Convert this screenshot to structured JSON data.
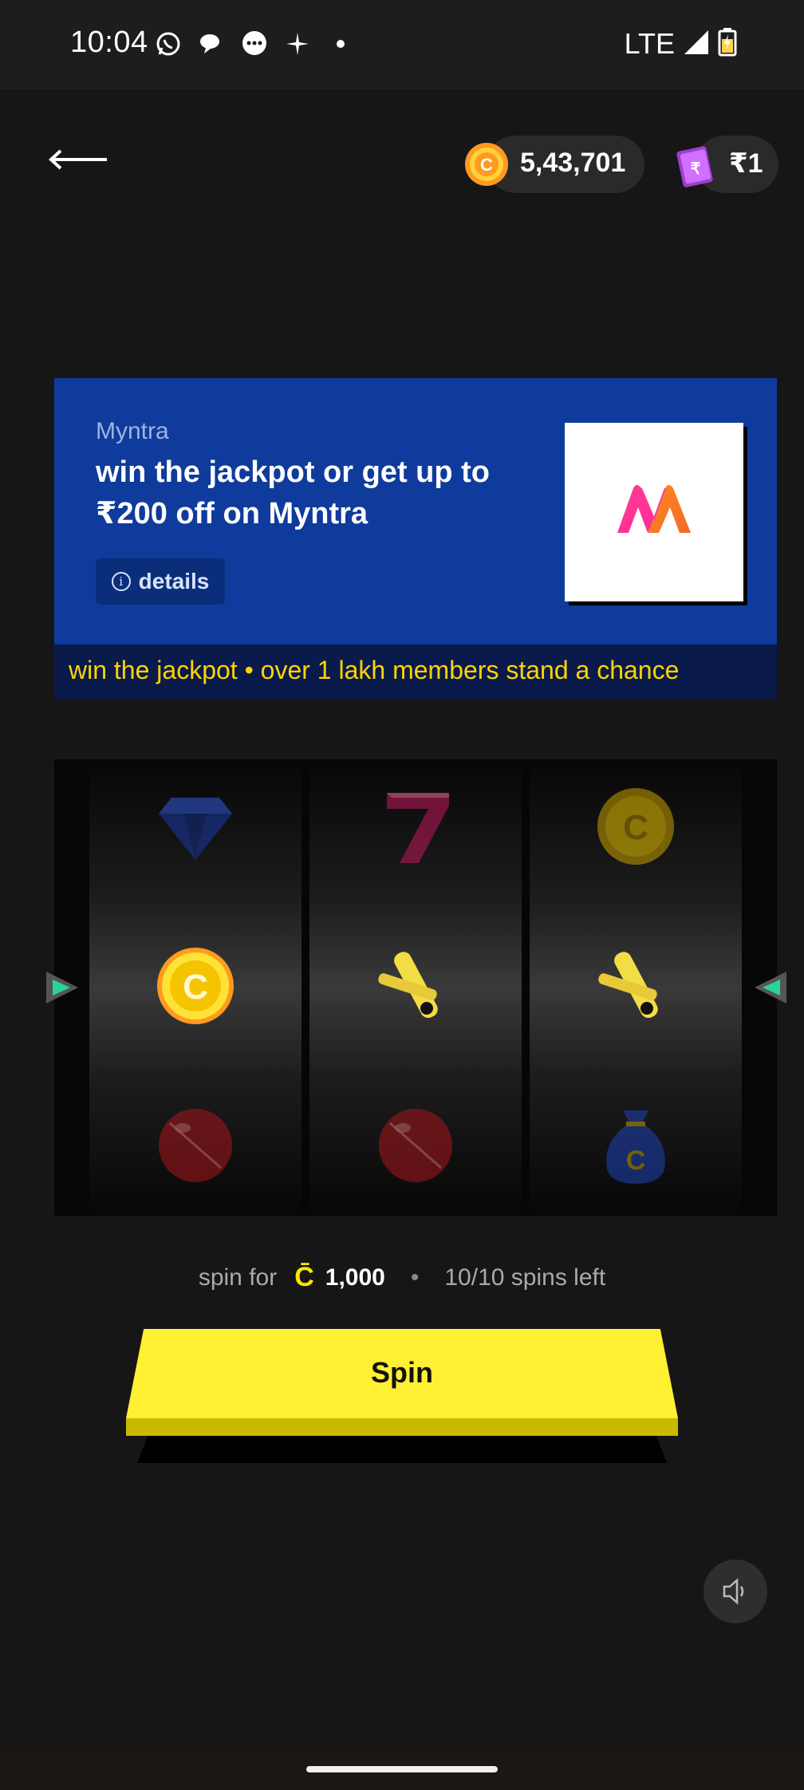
{
  "status_bar": {
    "time": "10:04",
    "network": "LTE"
  },
  "header": {
    "coins": "5,43,701",
    "rupee_balance": "₹1"
  },
  "banner": {
    "brand": "Myntra",
    "title": "win the jackpot or get up to ₹200 off on Myntra",
    "details_label": "details",
    "ticker": "win the jackpot  •  over 1 lakh members stand a chance"
  },
  "slot": {
    "reels": [
      [
        "diamond-icon",
        "coin-icon",
        "cricket-ball-icon"
      ],
      [
        "seven-icon",
        "cricket-bats-icon",
        "cricket-ball-icon"
      ],
      [
        "coin-icon",
        "cricket-bats-icon",
        "money-bag-icon"
      ]
    ]
  },
  "spin": {
    "spin_for_label": "spin for",
    "currency_symbol": "C̄",
    "cost": "1,000",
    "separator": "•",
    "spins_left": "10/10 spins left",
    "button_label": "Spin"
  },
  "colors": {
    "banner_bg": "#0f3b9c",
    "spin_button": "#fff033",
    "ticker_text": "#ffd400"
  }
}
